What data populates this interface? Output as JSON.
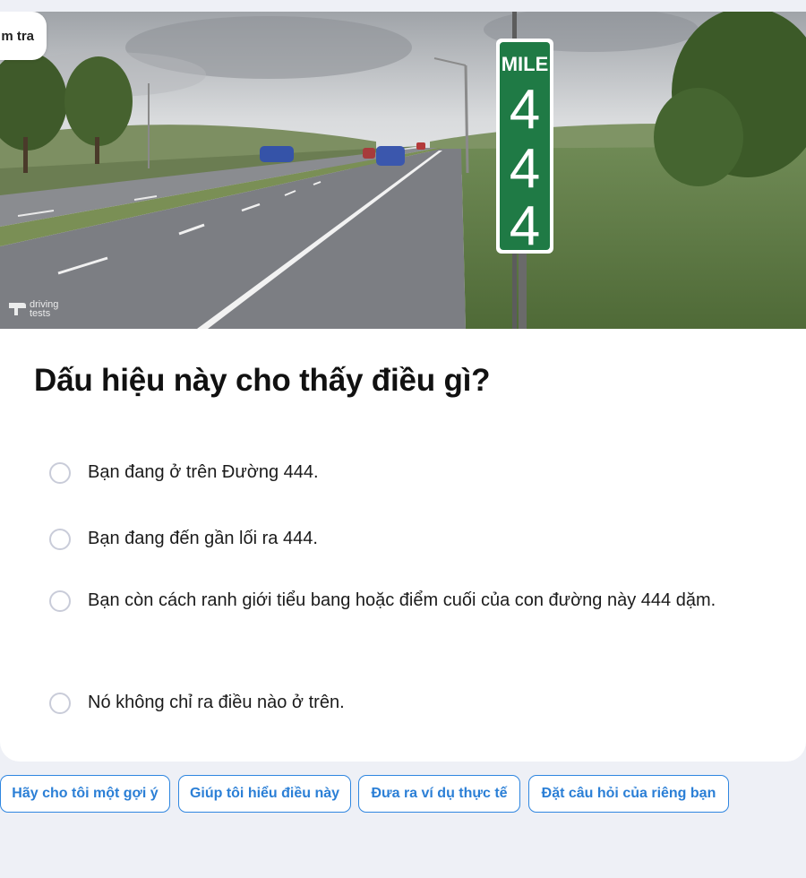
{
  "top_tab": {
    "label": "m tra"
  },
  "scene": {
    "sign_heading": "MILE",
    "sign_digits": [
      "4",
      "4",
      "4"
    ],
    "sign_color": "#1f7a45",
    "watermark_icon": "driving-tests-logo-icon",
    "watermark_text": "driving tests"
  },
  "question": {
    "text": "Dấu hiệu này cho thấy điều gì?"
  },
  "options": [
    {
      "text": "Bạn đang ở trên Đường 444."
    },
    {
      "text": "Bạn đang đến gần lối ra 444."
    },
    {
      "text": "Bạn còn cách ranh giới tiểu bang hoặc điểm cuối của con đường này 444 dặm."
    },
    {
      "text": "Nó không chỉ ra điều nào ở trên."
    }
  ],
  "chips": [
    {
      "label": "Hãy cho tôi một gợi ý"
    },
    {
      "label": "Giúp tôi hiểu điều này"
    },
    {
      "label": "Đưa ra ví dụ thực tế"
    },
    {
      "label": "Đặt câu hỏi của riêng bạn"
    }
  ],
  "colors": {
    "accent": "#2f86e0",
    "background": "#eef0f6",
    "radio_border": "#c9ccd9"
  }
}
